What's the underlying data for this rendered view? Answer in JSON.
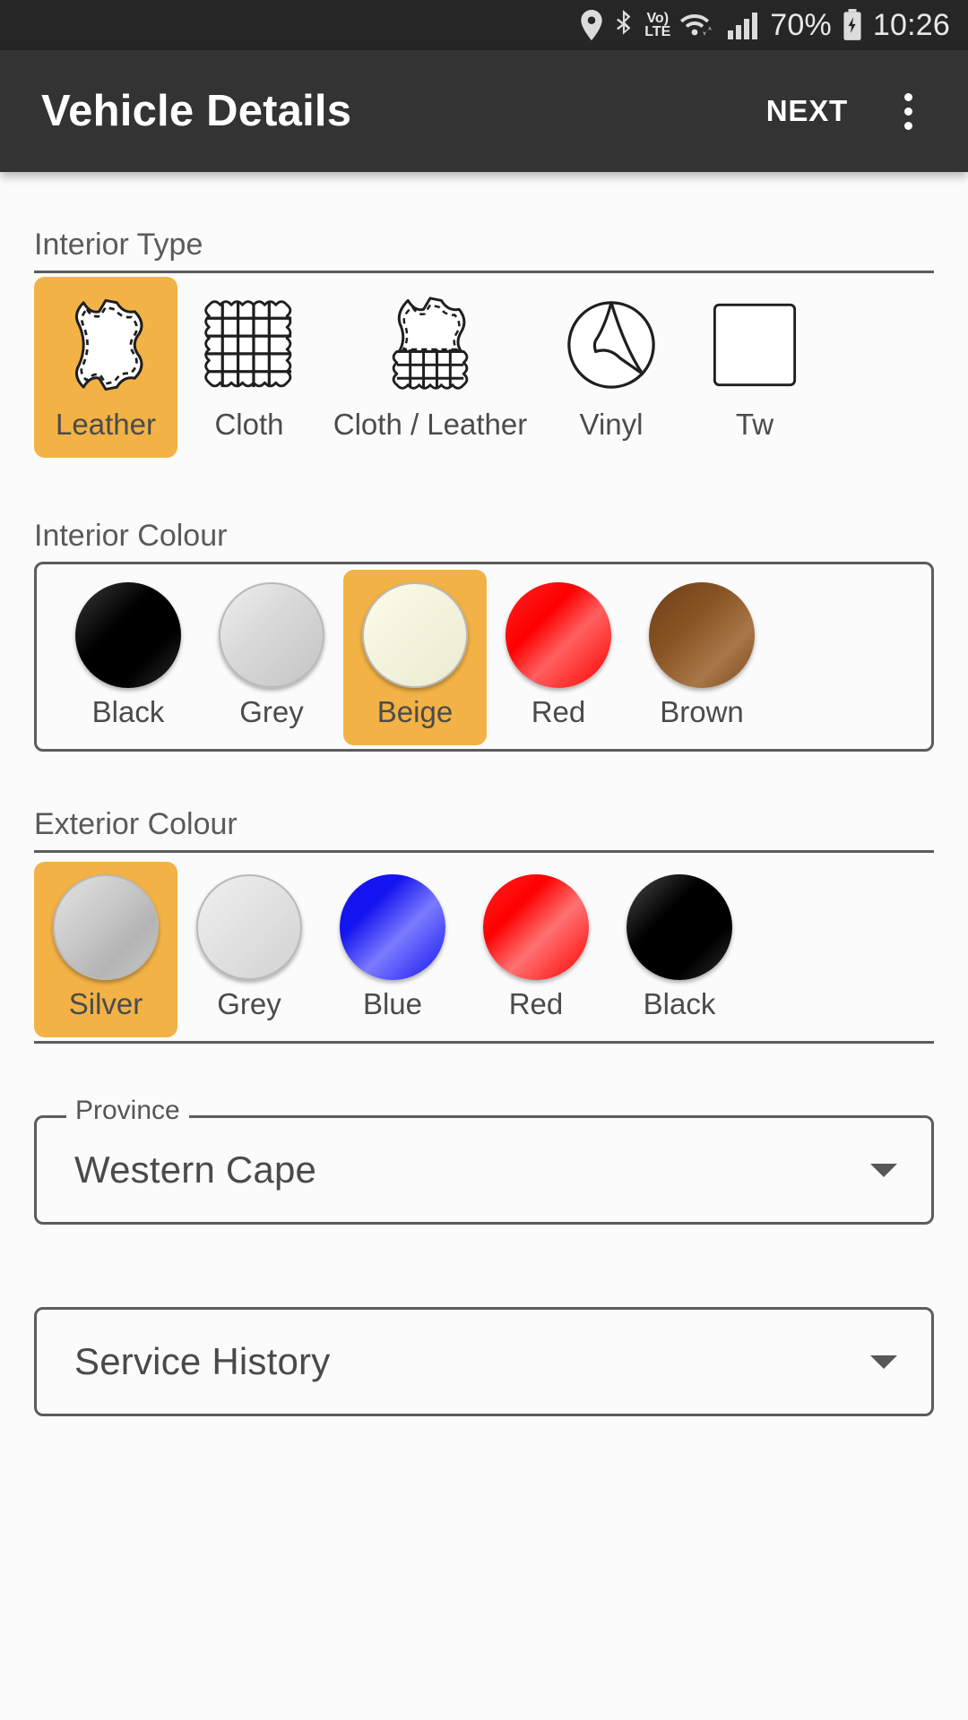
{
  "status_bar": {
    "icons": [
      "location-pin-icon",
      "bluetooth-icon",
      "volte-icon",
      "wifi-icon",
      "signal-bars-icon",
      "battery-charging-icon"
    ],
    "volte_line1": "Vo)",
    "volte_line2": "LTE",
    "battery_percent": "70%",
    "time": "10:26"
  },
  "app_bar": {
    "title": "Vehicle Details",
    "next_label": "NEXT",
    "overflow_label": "More options"
  },
  "colors": {
    "accent": "#f2b246",
    "app_bar_bg": "#333333",
    "status_bar_bg": "#262626",
    "page_bg": "#fbfbfb",
    "border": "#5c5c5c",
    "text": "#4b4b4b"
  },
  "sections": {
    "interior_type": {
      "label": "Interior Type",
      "selected": "Leather",
      "items": [
        {
          "label": "Leather",
          "icon": "leather-hide-icon",
          "selected": true
        },
        {
          "label": "Cloth",
          "icon": "cloth-weave-icon",
          "selected": false
        },
        {
          "label": "Cloth / Leather",
          "icon": "cloth-leather-icon",
          "selected": false
        },
        {
          "label": "Vinyl",
          "icon": "vinyl-circle-peel-icon",
          "selected": false
        },
        {
          "label": "Tw",
          "icon": "tweed-icon",
          "selected": false
        }
      ]
    },
    "interior_colour": {
      "label": "Interior Colour",
      "selected": "Beige",
      "items": [
        {
          "label": "Black",
          "hex": "#000000",
          "selected": false
        },
        {
          "label": "Grey",
          "hex": "#cccccc",
          "selected": false
        },
        {
          "label": "Beige",
          "hex": "#f2f2dd",
          "selected": true
        },
        {
          "label": "Red",
          "hex": "#fe0000",
          "selected": false
        },
        {
          "label": "Brown",
          "hex": "#8a5524",
          "selected": false
        }
      ]
    },
    "exterior_colour": {
      "label": "Exterior Colour",
      "selected": "Silver",
      "items": [
        {
          "label": "Silver",
          "hex": "#c3c3c3",
          "selected": true
        },
        {
          "label": "Grey",
          "hex": "#dcdcdc",
          "selected": false
        },
        {
          "label": "Blue",
          "hex": "#1414f0",
          "selected": false
        },
        {
          "label": "Red",
          "hex": "#fe0000",
          "selected": false
        },
        {
          "label": "Black",
          "hex": "#000000",
          "selected": false
        }
      ]
    }
  },
  "fields": {
    "province": {
      "label": "Province",
      "value": "Western Cape",
      "caret": "chevron-down-icon"
    },
    "service_history": {
      "label": "",
      "value": "Service History",
      "caret": "chevron-down-icon"
    }
  }
}
